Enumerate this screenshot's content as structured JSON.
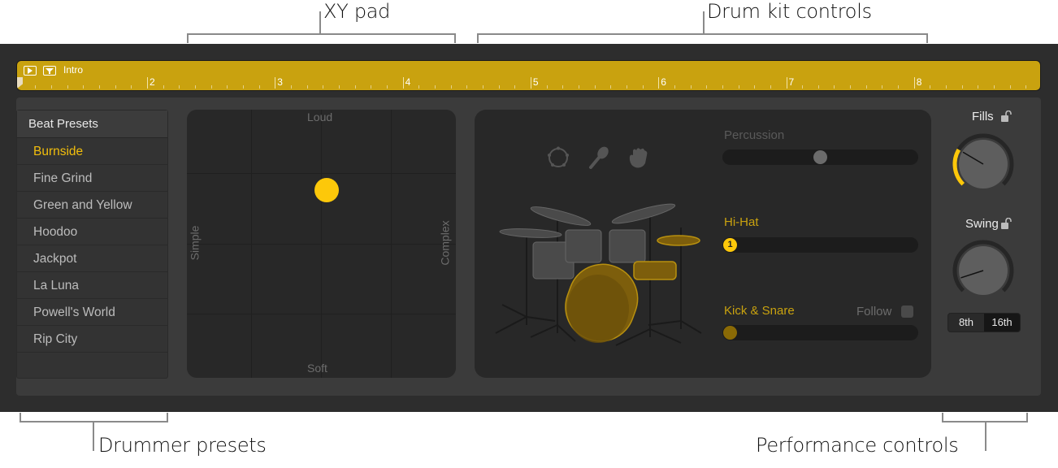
{
  "callouts": {
    "xy_pad": "XY pad",
    "drum_kit_controls": "Drum kit controls",
    "drummer_presets": "Drummer presets",
    "performance_controls": "Performance controls"
  },
  "region": {
    "name": "Intro",
    "color": "#c9a20f",
    "ruler_numbers": [
      "2",
      "3",
      "4",
      "5",
      "6",
      "7",
      "8"
    ]
  },
  "presets": {
    "header": "Beat Presets",
    "selected": "Burnside",
    "items": [
      "Burnside",
      "Fine Grind",
      "Green and Yellow",
      "Hoodoo",
      "Jackpot",
      "La Luna",
      "Powell's World",
      "Rip City"
    ]
  },
  "xy_pad": {
    "top_label": "Loud",
    "bottom_label": "Soft",
    "left_label": "Simple",
    "right_label": "Complex",
    "puck_x": 0.52,
    "puck_y": 0.3,
    "puck_color": "#fdc80a"
  },
  "kit": {
    "percussion_icons": [
      "tambourine-icon",
      "shaker-icon",
      "hand-clap-icon"
    ],
    "percussion": {
      "label": "Percussion",
      "value": 0.5
    },
    "hihat": {
      "label": "Hi-Hat",
      "value": 0.0,
      "knob_text": "1"
    },
    "kick_snare": {
      "label": "Kick & Snare",
      "value": 0.0
    },
    "follow": {
      "label": "Follow",
      "checked": false
    },
    "accent_color": "#c9a20f"
  },
  "performance": {
    "fills": {
      "label": "Fills",
      "value": 0.28,
      "locked": false
    },
    "swing": {
      "label": "Swing",
      "value": 0.1,
      "locked": false
    },
    "note_resolution": {
      "options": [
        "8th",
        "16th"
      ],
      "selected": "16th"
    }
  }
}
